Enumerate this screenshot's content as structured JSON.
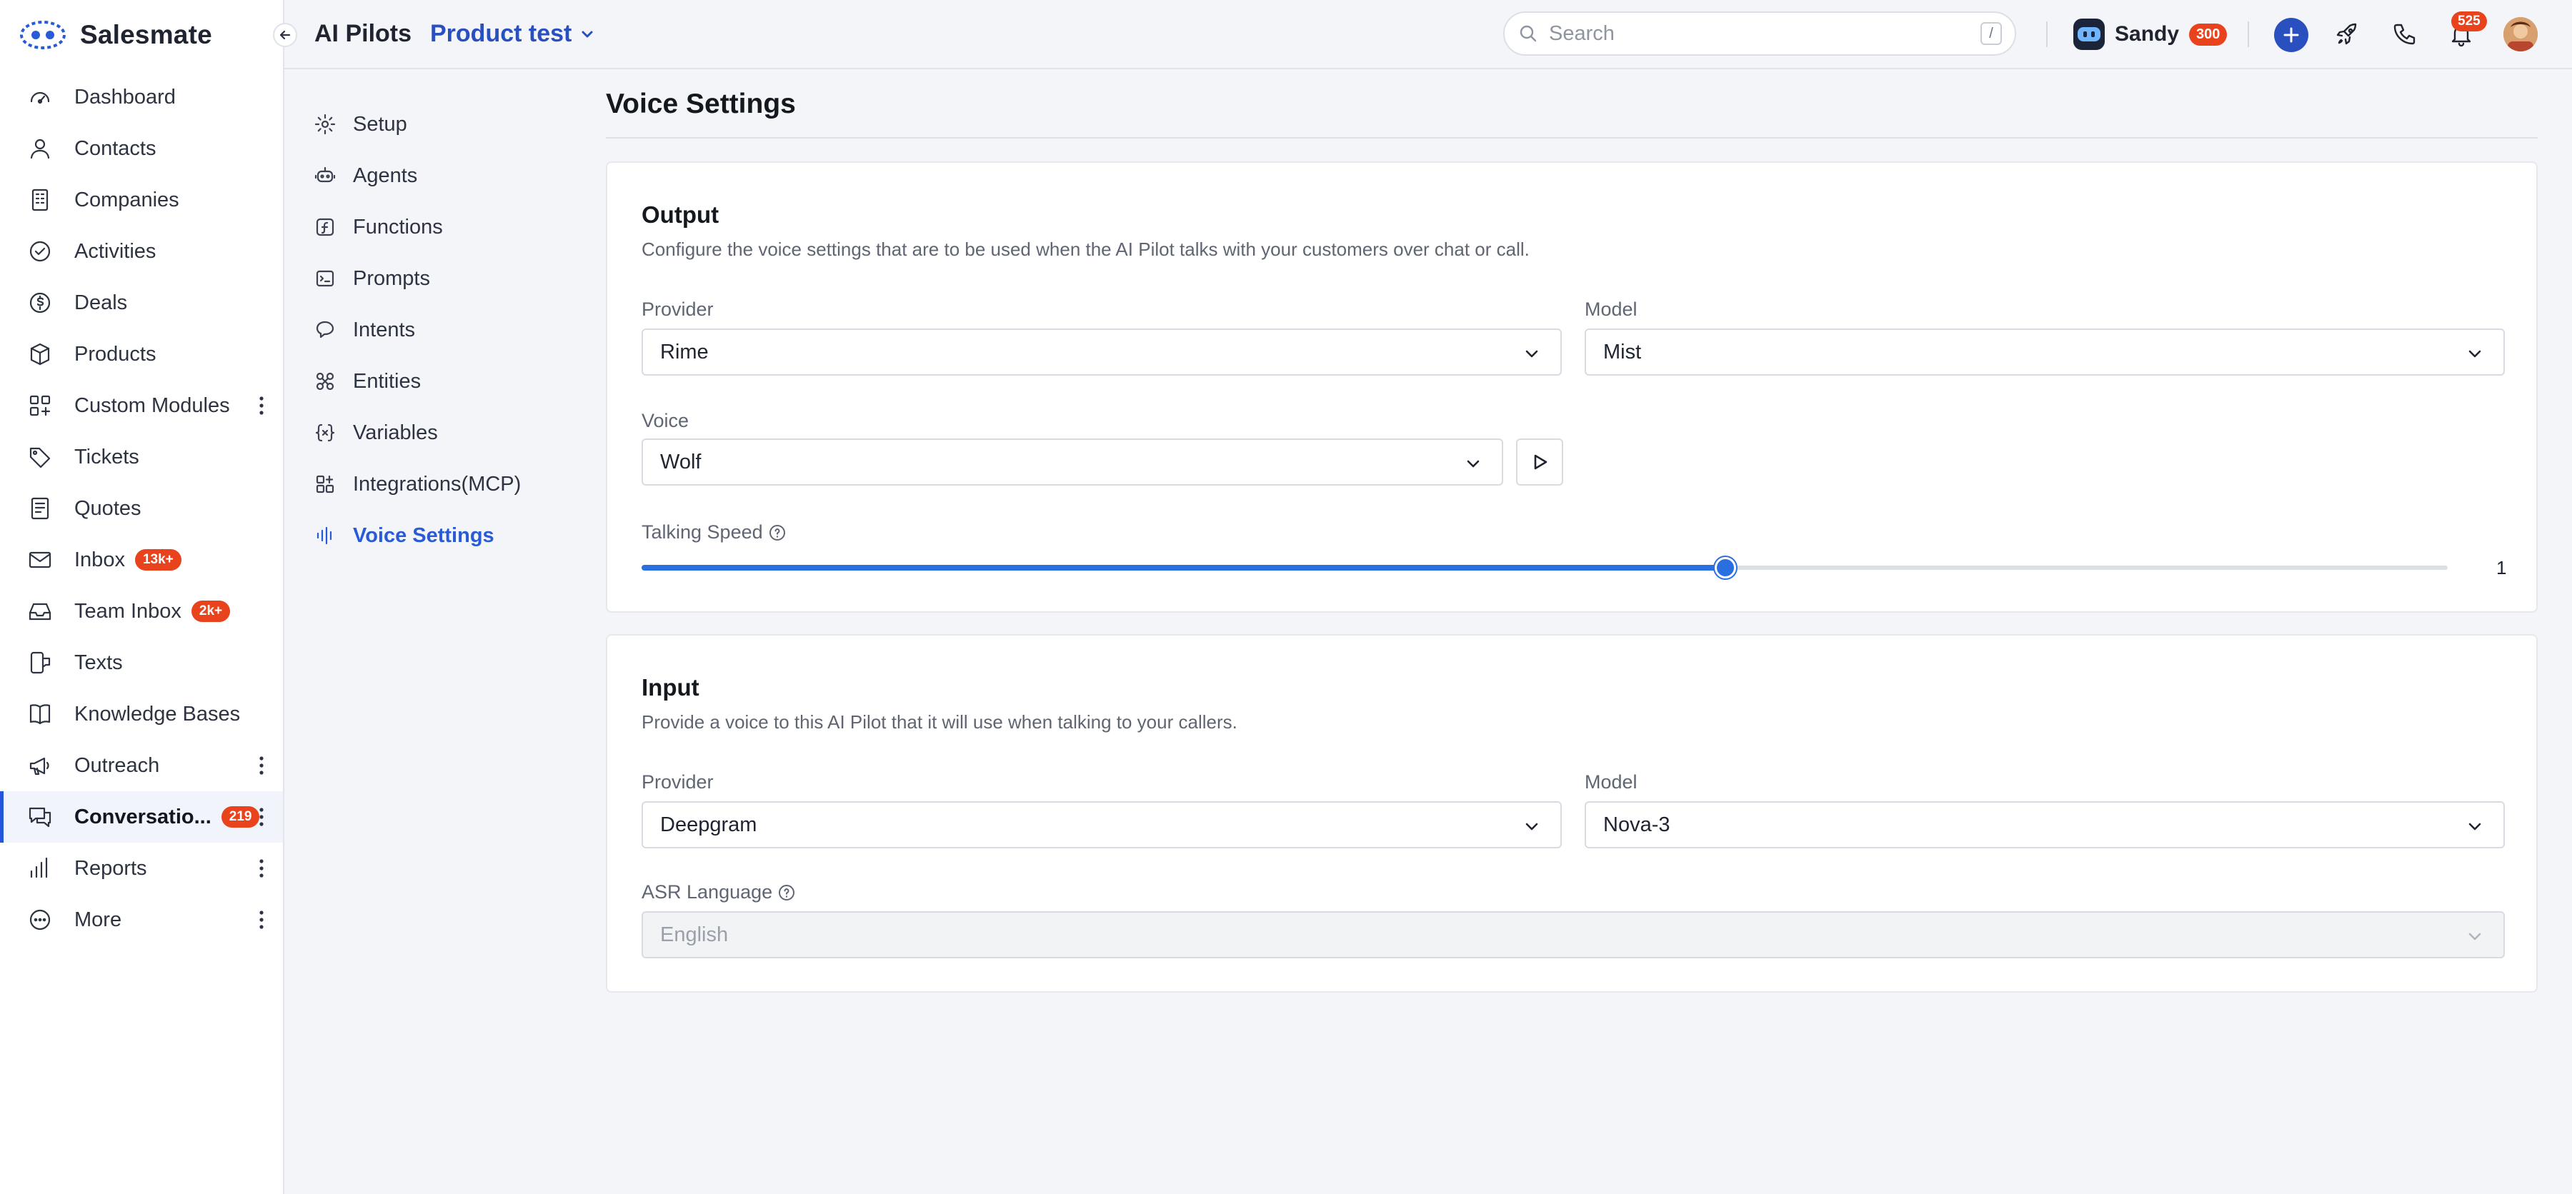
{
  "brand": {
    "name": "Salesmate"
  },
  "nav": {
    "items": [
      {
        "label": "Dashboard",
        "icon": "dashboard-icon"
      },
      {
        "label": "Contacts",
        "icon": "person-icon"
      },
      {
        "label": "Companies",
        "icon": "building-icon"
      },
      {
        "label": "Activities",
        "icon": "check-circle-icon"
      },
      {
        "label": "Deals",
        "icon": "dollar-icon"
      },
      {
        "label": "Products",
        "icon": "box-icon"
      },
      {
        "label": "Custom Modules",
        "icon": "grid-plus-icon"
      },
      {
        "label": "Tickets",
        "icon": "tag-icon"
      },
      {
        "label": "Quotes",
        "icon": "document-icon"
      },
      {
        "label": "Inbox",
        "icon": "mail-icon",
        "badge": "13k+"
      },
      {
        "label": "Team Inbox",
        "icon": "tray-icon",
        "badge": "2k+"
      },
      {
        "label": "Texts",
        "icon": "phone-text-icon"
      },
      {
        "label": "Knowledge Bases",
        "icon": "book-icon"
      },
      {
        "label": "Outreach",
        "icon": "megaphone-icon"
      },
      {
        "label": "Conversatio...",
        "icon": "chat-icon",
        "badge": "219"
      },
      {
        "label": "Reports",
        "icon": "bar-chart-icon"
      },
      {
        "label": "More",
        "icon": "more-circle-icon"
      }
    ]
  },
  "topbar": {
    "app": "AI Pilots",
    "current": "Product test",
    "search_placeholder": "Search",
    "search_shortcut": "/",
    "user_name": "Sandy",
    "user_badge": "300",
    "notifications_badge": "525"
  },
  "subnav": {
    "items": [
      {
        "label": "Setup",
        "icon": "gear-icon"
      },
      {
        "label": "Agents",
        "icon": "robot-icon"
      },
      {
        "label": "Functions",
        "icon": "function-icon"
      },
      {
        "label": "Prompts",
        "icon": "terminal-icon"
      },
      {
        "label": "Intents",
        "icon": "speech-icon"
      },
      {
        "label": "Entities",
        "icon": "entities-icon"
      },
      {
        "label": "Variables",
        "icon": "braces-icon"
      },
      {
        "label": "Integrations(MCP)",
        "icon": "integrations-icon"
      },
      {
        "label": "Voice Settings",
        "icon": "waveform-icon"
      }
    ]
  },
  "page": {
    "title": "Voice Settings",
    "output": {
      "title": "Output",
      "description": "Configure the voice settings that are to be used when the AI Pilot talks with your customers over chat or call.",
      "provider_label": "Provider",
      "provider_value": "Rime",
      "model_label": "Model",
      "model_value": "Mist",
      "voice_label": "Voice",
      "voice_value": "Wolf",
      "speed_label": "Talking Speed",
      "speed_value": "1",
      "speed_fraction": 0.6
    },
    "input": {
      "title": "Input",
      "description": "Provide a voice to this AI Pilot that it will use when talking to your callers.",
      "provider_label": "Provider",
      "provider_value": "Deepgram",
      "model_label": "Model",
      "model_value": "Nova-3",
      "asr_label": "ASR Language",
      "asr_value": "English"
    }
  },
  "colors": {
    "accent": "#2a4fbf",
    "active_link": "#2a5bd7",
    "badge": "#e8431c",
    "slider": "#2a6fe0"
  }
}
